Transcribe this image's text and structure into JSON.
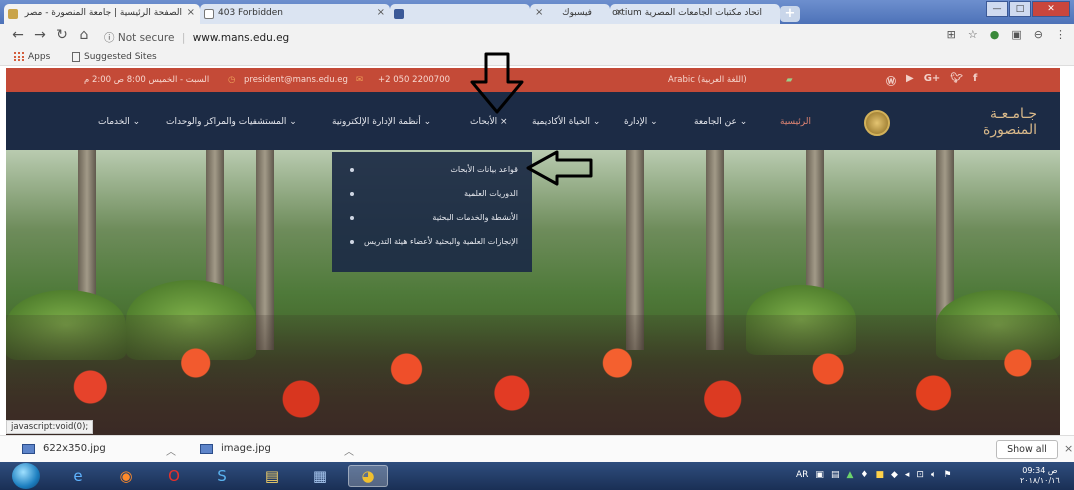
{
  "browser": {
    "tabs": [
      {
        "label": "الصفحة الرئيسية | جامعة المنصورة - مصر",
        "active": true
      },
      {
        "label": "403 Forbidden",
        "active": false
      },
      {
        "label": "",
        "active": false
      },
      {
        "label": "فيسبوك",
        "active": false
      },
      {
        "label": "اتحاد مكتبات الجامعات المصرية ortium",
        "active": false
      }
    ],
    "new_tab_label": "+",
    "tab_close": "×",
    "win_min": "—",
    "win_max": "□",
    "win_close": "✕",
    "security_text": "Not secure",
    "url": "www.mans.edu.eg",
    "bookmarks": {
      "apps": "Apps",
      "suggested": "Suggested Sites"
    }
  },
  "site": {
    "topbar": {
      "language": "Arabic (اللغة العربية)",
      "phone": "+2 050 2200700",
      "email": "president@mans.edu.eg",
      "hours": "السبت - الخميس 8:00 ص 2:00 م"
    },
    "social_icons": [
      "wordpress-icon",
      "youtube-icon",
      "google-plus-icon",
      "twitter-icon",
      "facebook-icon"
    ],
    "logo": {
      "line1": "جـامـعـة",
      "line2": "المنصورة"
    },
    "nav": [
      {
        "label": "الرئيسية"
      },
      {
        "label": "عن الجامعة ⌄"
      },
      {
        "label": "الإدارة ⌄"
      },
      {
        "label": "الحياة الأكاديمية ⌄"
      },
      {
        "label": "الأبحاث ×"
      },
      {
        "label": "أنظمة الإدارة الإلكترونية ⌄"
      },
      {
        "label": "المستشفيات والمراكز والوحدات ⌄"
      },
      {
        "label": "الخدمات ⌄"
      }
    ],
    "dropdown": [
      {
        "label": "قواعد بيانات الأبحاث"
      },
      {
        "label": "الدوريات العلمية"
      },
      {
        "label": "الأنشطة والخدمات البحثية"
      },
      {
        "label": "الإنجازات العلمية والبحثية لأعضاء هيئة التدريس"
      }
    ]
  },
  "status_text": "javascript:void(0);",
  "downloads": {
    "items": [
      {
        "name": "622x350.jpg"
      },
      {
        "name": "image.jpg"
      }
    ],
    "show_all": "Show all",
    "close": "×"
  },
  "taskbar": {
    "lang": "AR",
    "time": "09:34 ص",
    "date": "٢٠١٨/١٠/١٦"
  },
  "colors": {
    "topbar": "#c44a37",
    "navbar": "#1c2b45",
    "nav_home": "#e08573",
    "logo_text": "#d9b98a"
  }
}
